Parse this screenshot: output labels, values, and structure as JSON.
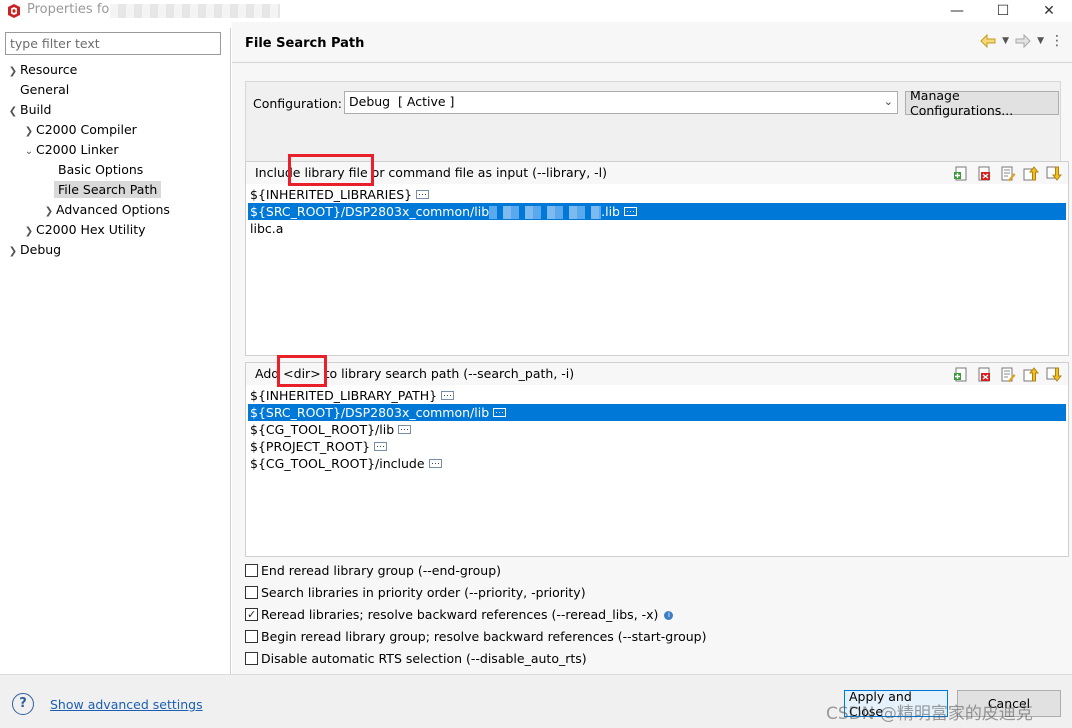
{
  "window": {
    "title": "Properties for"
  },
  "sidebar": {
    "filter_placeholder": "type filter text",
    "items": [
      {
        "label": "Resource"
      },
      {
        "label": "General"
      },
      {
        "label": "Build"
      },
      {
        "label": "C2000 Compiler"
      },
      {
        "label": "C2000 Linker"
      },
      {
        "label": "Basic Options"
      },
      {
        "label": "File Search Path"
      },
      {
        "label": "Advanced Options"
      },
      {
        "label": "C2000 Hex Utility"
      },
      {
        "label": "Debug"
      }
    ]
  },
  "main": {
    "title": "File Search Path",
    "configuration": {
      "label": "Configuration:",
      "value": "Debug  [ Active ]",
      "manage_button": "Manage Configurations..."
    },
    "library_list": {
      "header": "Include library file or command file as input (--library, -l)",
      "rows": [
        {
          "text": "${INHERITED_LIBRARIES}",
          "selected": false,
          "dots": true
        },
        {
          "text": "${SRC_ROOT}/DSP2803x_common/lib",
          "suffix": ".lib",
          "selected": true,
          "dots": true
        },
        {
          "text": "libc.a",
          "selected": false,
          "dots": false
        }
      ]
    },
    "search_path_list": {
      "header": "Add <dir> to library search path (--search_path, -i)",
      "rows": [
        {
          "text": "${INHERITED_LIBRARY_PATH}",
          "selected": false,
          "dots": true
        },
        {
          "text": "${SRC_ROOT}/DSP2803x_common/lib",
          "selected": true,
          "dots": true
        },
        {
          "text": "${CG_TOOL_ROOT}/lib",
          "selected": false,
          "dots": true
        },
        {
          "text": "${PROJECT_ROOT}",
          "selected": false,
          "dots": true
        },
        {
          "text": "${CG_TOOL_ROOT}/include",
          "selected": false,
          "dots": true
        }
      ]
    },
    "options": [
      {
        "label": "End reread library group (--end-group)",
        "checked": false,
        "info": false
      },
      {
        "label": "Search libraries in priority order (--priority, -priority)",
        "checked": false,
        "info": false
      },
      {
        "label": "Reread libraries; resolve backward references (--reread_libs, -x)",
        "checked": true,
        "info": true
      },
      {
        "label": "Begin reread library group; resolve backward references (--start-group)",
        "checked": false,
        "info": false
      },
      {
        "label": "Disable automatic RTS selection (--disable_auto_rts)",
        "checked": false,
        "info": false
      }
    ]
  },
  "footer": {
    "advanced_link": "Show advanced settings",
    "apply_close": "Apply and Close",
    "cancel": "Cancel",
    "watermark": "CSDN @精明富家的皮迪克"
  },
  "colors": {
    "selection": "#0078d7",
    "highlight_box": "#e8202a",
    "link": "#1a5fb4"
  }
}
